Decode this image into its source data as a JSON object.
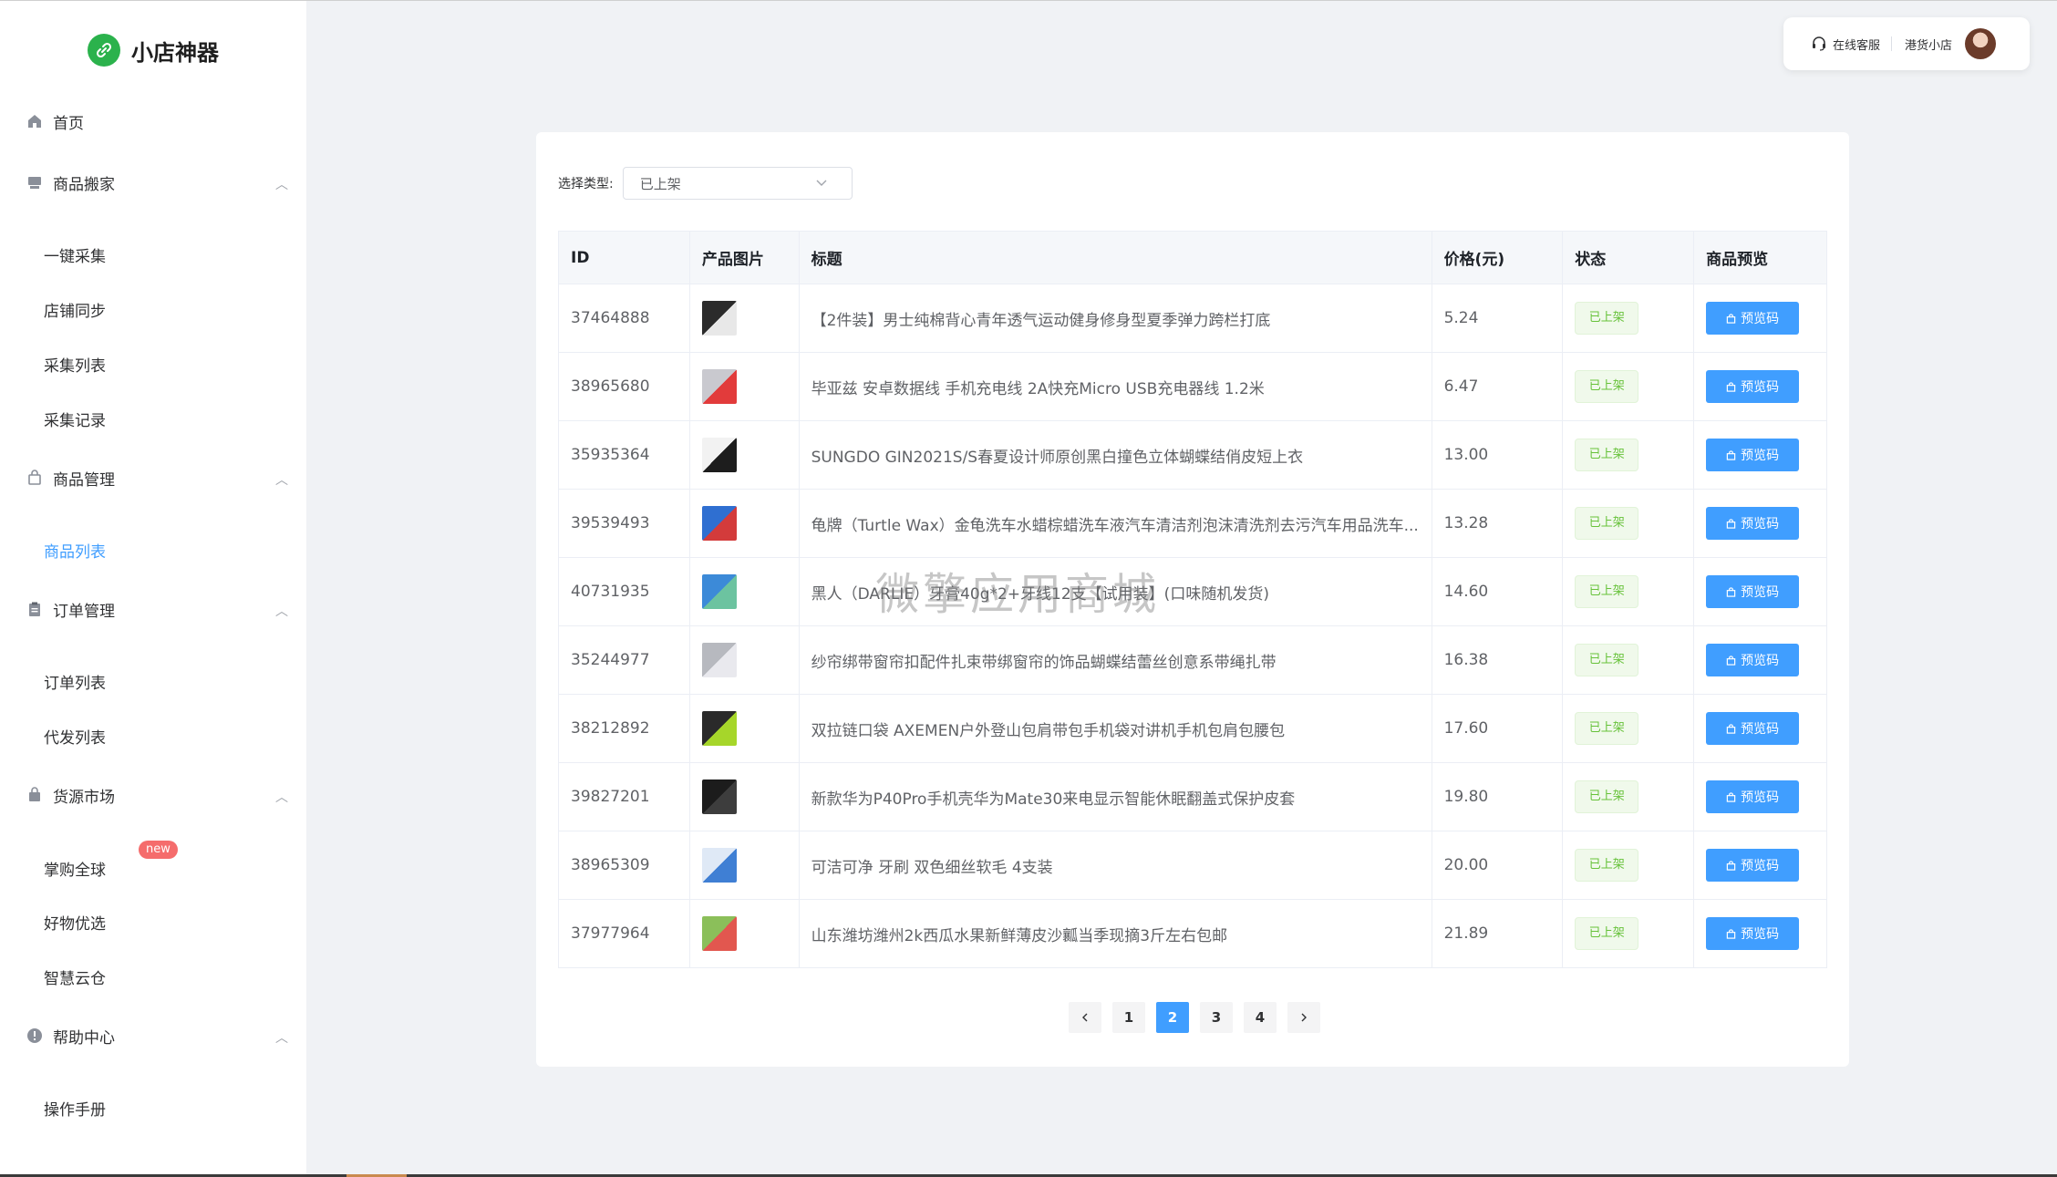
{
  "brand": {
    "name": "小店神器",
    "color": "#2bb24c"
  },
  "header": {
    "service_label": "在线客服",
    "shop_name": "港货小店"
  },
  "sidebar": {
    "home": "首页",
    "groups": [
      {
        "label": "商品搬家",
        "items": [
          "一键采集",
          "店铺同步",
          "采集列表",
          "采集记录"
        ]
      },
      {
        "label": "商品管理",
        "items": [
          "商品列表"
        ]
      },
      {
        "label": "订单管理",
        "items": [
          "订单列表",
          "代发列表"
        ]
      },
      {
        "label": "货源市场",
        "items": [
          "掌购全球",
          "好物优选",
          "智慧云仓"
        ]
      },
      {
        "label": "帮助中心",
        "items": [
          "操作手册"
        ]
      }
    ],
    "new_badge": "new",
    "active_item": "商品列表"
  },
  "filter": {
    "label": "选择类型:",
    "selected": "已上架"
  },
  "table": {
    "headers": [
      "ID",
      "产品图片",
      "标题",
      "价格(元)",
      "状态",
      "商品预览"
    ],
    "rows": [
      {
        "id": "37464888",
        "title": "【2件装】男士纯棉背心青年透气运动健身修身型夏季弹力跨栏打底",
        "price": "5.24",
        "status": "已上架",
        "action": "预览码"
      },
      {
        "id": "38965680",
        "title": "毕亚兹 安卓数据线 手机充电线 2A快充Micro USB充电器线 1.2米",
        "price": "6.47",
        "status": "已上架",
        "action": "预览码"
      },
      {
        "id": "35935364",
        "title": "SUNGDO GIN2021S/S春夏设计师原创黑白撞色立体蝴蝶结俏皮短上衣",
        "price": "13.00",
        "status": "已上架",
        "action": "预览码"
      },
      {
        "id": "39539493",
        "title": "龟牌（Turtle Wax）金龟洗车水蜡棕蜡洗车液汽车清洁剂泡沫清洗剂去污汽车用品洗车...",
        "price": "13.28",
        "status": "已上架",
        "action": "预览码"
      },
      {
        "id": "40731935",
        "title": "黑人（DARLIE）牙膏40g*2+牙线12支【试用装】(口味随机发货)",
        "price": "14.60",
        "status": "已上架",
        "action": "预览码"
      },
      {
        "id": "35244977",
        "title": "纱帘绑带窗帘扣配件扎束带绑窗帘的饰品蝴蝶结蕾丝创意系带绳扎带",
        "price": "16.38",
        "status": "已上架",
        "action": "预览码"
      },
      {
        "id": "38212892",
        "title": "双拉链口袋 AXEMEN户外登山包肩带包手机袋对讲机手机包肩包腰包",
        "price": "17.60",
        "status": "已上架",
        "action": "预览码"
      },
      {
        "id": "39827201",
        "title": "新款华为P40Pro手机壳华为Mate30来电显示智能休眠翻盖式保护皮套",
        "price": "19.80",
        "status": "已上架",
        "action": "预览码"
      },
      {
        "id": "38965309",
        "title": "可洁可净 牙刷 双色细丝软毛 4支装",
        "price": "20.00",
        "status": "已上架",
        "action": "预览码"
      },
      {
        "id": "37977964",
        "title": "山东潍坊潍州2k西瓜水果新鲜薄皮沙瓤当季现摘3斤左右包邮",
        "price": "21.89",
        "status": "已上架",
        "action": "预览码"
      }
    ]
  },
  "pagination": {
    "pages": [
      "1",
      "2",
      "3",
      "4"
    ],
    "current": "2",
    "prev_icon": "chevron-left-icon",
    "next_icon": "chevron-right-icon"
  },
  "watermark": "微擎应用商城",
  "colors": {
    "primary": "#409eff",
    "success": "#67c23a",
    "danger": "#f56c6c"
  }
}
